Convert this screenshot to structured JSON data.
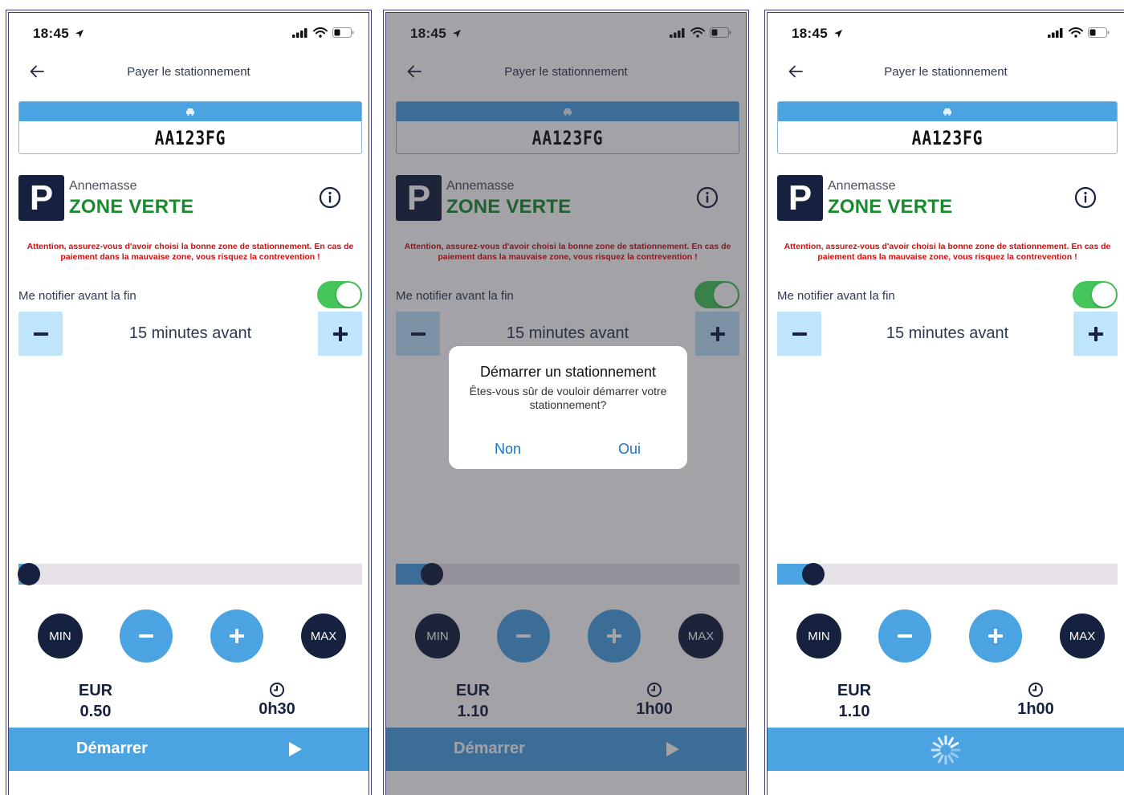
{
  "colors": {
    "accent": "#4ba3e2",
    "navy": "#16213f",
    "zone_green": "#1a8a2e",
    "warning_red": "#d10f0f",
    "toggle_on": "#45c65a",
    "dialog_link": "#1a73c9"
  },
  "screens": [
    {
      "status": {
        "time": "18:45"
      },
      "header": {
        "title": "Payer le stationnement"
      },
      "plate": {
        "number": "AA123FG"
      },
      "zone": {
        "city": "Annemasse",
        "name": "ZONE VERTE"
      },
      "warning": "Attention, assurez-vous d'avoir choisi la bonne zone de stationnement. En cas de paiement dans la mauvaise zone, vous risquez la contrevention !",
      "notify": {
        "label": "Me notifier avant la fin",
        "enabled": true
      },
      "reminder": {
        "value": "15 minutes avant"
      },
      "duration_slider": {
        "fraction": 0.03
      },
      "controls": {
        "min_label": "MIN",
        "max_label": "MAX"
      },
      "price": {
        "currency": "EUR",
        "amount": "0.50"
      },
      "duration": "0h30",
      "start_button": {
        "label": "Démarrer",
        "loading": false
      }
    },
    {
      "status": {
        "time": "18:45"
      },
      "header": {
        "title": "Payer le stationnement"
      },
      "plate": {
        "number": "AA123FG"
      },
      "zone": {
        "city": "Annemasse",
        "name": "ZONE VERTE"
      },
      "warning": "Attention, assurez-vous d'avoir choisi la bonne zone de stationnement. En cas de paiement dans la mauvaise zone, vous risquez la contrevention !",
      "notify": {
        "label": "Me notifier avant la fin",
        "enabled": true
      },
      "reminder": {
        "value": "15 minutes avant"
      },
      "duration_slider": {
        "fraction": 0.105
      },
      "controls": {
        "min_label": "MIN",
        "max_label": "MAX"
      },
      "price": {
        "currency": "EUR",
        "amount": "1.10"
      },
      "duration": "1h00",
      "start_button": {
        "label": "Démarrer",
        "loading": false
      },
      "dialog": {
        "title": "Démarrer un stationnement",
        "message": "Êtes-vous sûr de vouloir démarrer votre stationnement?",
        "no_label": "Non",
        "yes_label": "Oui"
      }
    },
    {
      "status": {
        "time": "18:45"
      },
      "header": {
        "title": "Payer le stationnement"
      },
      "plate": {
        "number": "AA123FG"
      },
      "zone": {
        "city": "Annemasse",
        "name": "ZONE VERTE"
      },
      "warning": "Attention, assurez-vous d'avoir choisi la bonne zone de stationnement. En cas de paiement dans la mauvaise zone, vous risquez la contrevention !",
      "notify": {
        "label": "Me notifier avant la fin",
        "enabled": true
      },
      "reminder": {
        "value": "15 minutes avant"
      },
      "duration_slider": {
        "fraction": 0.105
      },
      "controls": {
        "min_label": "MIN",
        "max_label": "MAX"
      },
      "price": {
        "currency": "EUR",
        "amount": "1.10"
      },
      "duration": "1h00",
      "start_button": {
        "label": "",
        "loading": true
      }
    }
  ]
}
